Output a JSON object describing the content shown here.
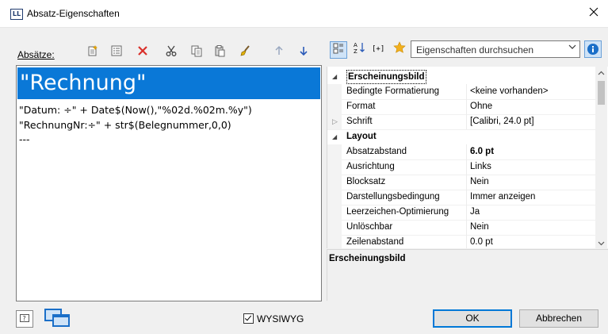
{
  "window": {
    "title": "Absatz-Eigenschaften",
    "app_icon_text": "LL"
  },
  "left_panel": {
    "label": "Absätze:",
    "editor": {
      "selected_line": "\"Rechnung\"",
      "lines": [
        "\"Datum: ÷\"  + Date$(Now(),\"%02d.%02m.%y\")",
        "\"RechnungNr:÷\" + str$(Belegnummer,0,0)",
        "---"
      ]
    }
  },
  "search": {
    "placeholder": "Eigenschaften durchsuchen"
  },
  "property_grid": {
    "rows": [
      {
        "type": "category",
        "name": "Erscheinungsbild",
        "value": ""
      },
      {
        "type": "prop",
        "name": "Bedingte Formatierung",
        "value": "<keine vorhanden>"
      },
      {
        "type": "prop",
        "name": "Format",
        "value": "Ohne"
      },
      {
        "type": "prop",
        "name": "Schrift",
        "value": "[Calibri, 24.0 pt]"
      },
      {
        "type": "category",
        "name": "Layout",
        "value": ""
      },
      {
        "type": "prop",
        "name": "Absatzabstand",
        "value": "6.0 pt"
      },
      {
        "type": "prop",
        "name": "Ausrichtung",
        "value": "Links"
      },
      {
        "type": "prop",
        "name": "Blocksatz",
        "value": "Nein"
      },
      {
        "type": "prop",
        "name": "Darstellungsbedingung",
        "value": "Immer anzeigen"
      },
      {
        "type": "prop",
        "name": "Leerzeichen-Optimierung",
        "value": "Ja"
      },
      {
        "type": "prop",
        "name": "Unlöschbar",
        "value": "Nein"
      },
      {
        "type": "prop",
        "name": "Zeilenabstand",
        "value": "0.0 pt"
      }
    ]
  },
  "description": {
    "title": "Erscheinungsbild"
  },
  "footer": {
    "wysiwyg_label": "WYSIWYG",
    "ok_label": "OK",
    "cancel_label": "Abbrechen",
    "help_label": "?"
  },
  "colors": {
    "selection": "#0a78d7",
    "accent": "#0078d7",
    "delete_red": "#d9302a"
  }
}
